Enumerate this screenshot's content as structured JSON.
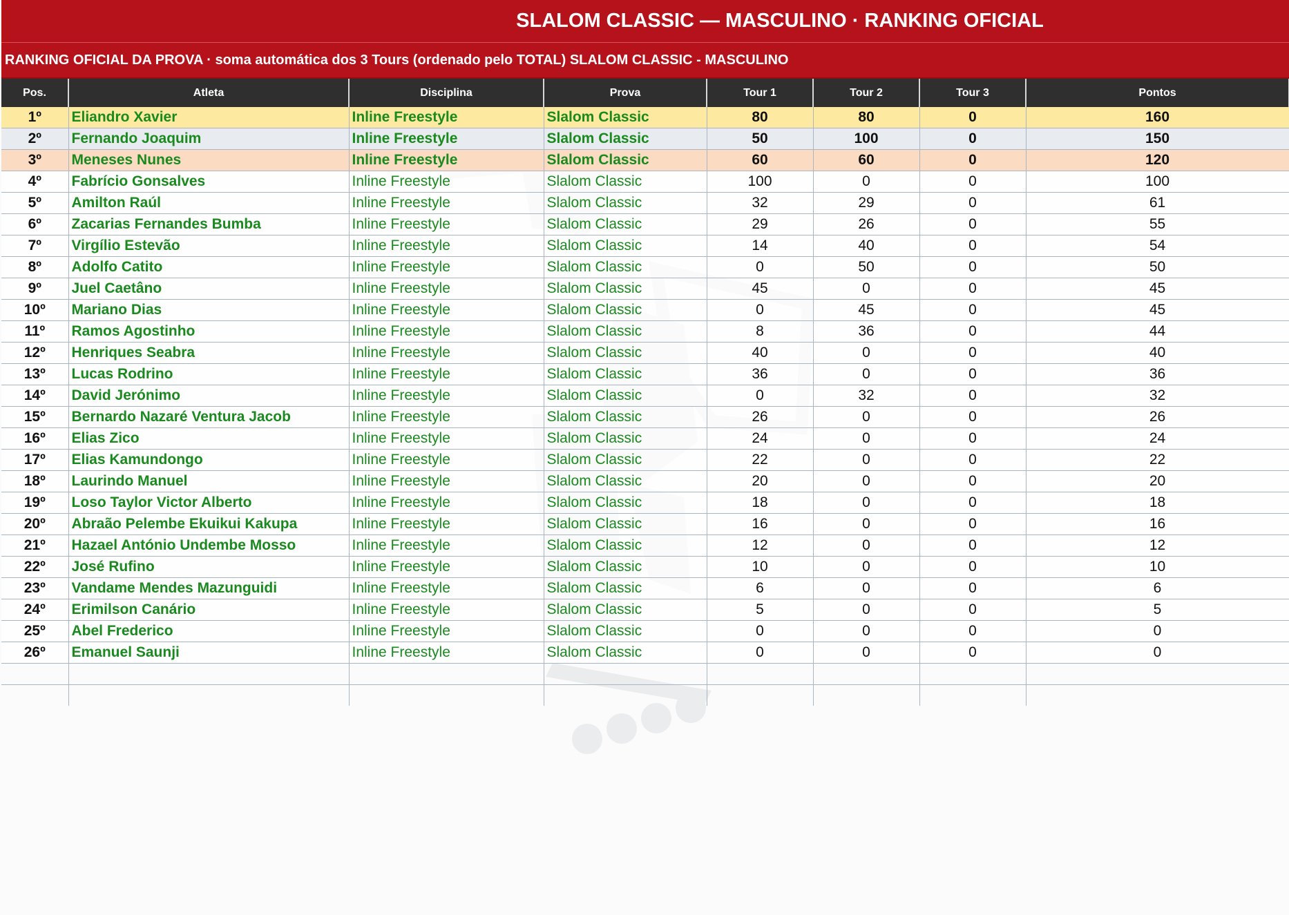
{
  "header": {
    "title": "SLALOM CLASSIC — MASCULINO  ·  RANKING OFICIAL",
    "subtitle": "RANKING OFICIAL DA PROVA  ·  soma automática dos 3 Tours (ordenado pelo TOTAL) SLALOM CLASSIC - MASCULINO"
  },
  "columns": [
    "Pos.",
    "Atleta",
    "Disciplina",
    "Prova",
    "Tour 1",
    "Tour 2",
    "Tour 3",
    "Pontos"
  ],
  "rows": [
    {
      "pos": "1º",
      "atleta": "Eliandro Xavier",
      "disciplina": "Inline Freestyle",
      "prova": "Slalom Classic",
      "t1": "80",
      "t2": "80",
      "t3": "0",
      "pontos": "160"
    },
    {
      "pos": "2º",
      "atleta": "Fernando Joaquim",
      "disciplina": "Inline Freestyle",
      "prova": "Slalom Classic",
      "t1": "50",
      "t2": "100",
      "t3": "0",
      "pontos": "150"
    },
    {
      "pos": "3º",
      "atleta": "Meneses Nunes",
      "disciplina": "Inline Freestyle",
      "prova": "Slalom Classic",
      "t1": "60",
      "t2": "60",
      "t3": "0",
      "pontos": "120"
    },
    {
      "pos": "4º",
      "atleta": "Fabrício Gonsalves",
      "disciplina": "Inline Freestyle",
      "prova": "Slalom Classic",
      "t1": "100",
      "t2": "0",
      "t3": "0",
      "pontos": "100"
    },
    {
      "pos": "5º",
      "atleta": "Amilton Raúl",
      "disciplina": "Inline Freestyle",
      "prova": "Slalom Classic",
      "t1": "32",
      "t2": "29",
      "t3": "0",
      "pontos": "61"
    },
    {
      "pos": "6º",
      "atleta": "Zacarias Fernandes Bumba",
      "disciplina": "Inline Freestyle",
      "prova": "Slalom Classic",
      "t1": "29",
      "t2": "26",
      "t3": "0",
      "pontos": "55"
    },
    {
      "pos": "7º",
      "atleta": "Virgílio Estevão",
      "disciplina": "Inline Freestyle",
      "prova": "Slalom Classic",
      "t1": "14",
      "t2": "40",
      "t3": "0",
      "pontos": "54"
    },
    {
      "pos": "8º",
      "atleta": "Adolfo Catito",
      "disciplina": "Inline Freestyle",
      "prova": "Slalom Classic",
      "t1": "0",
      "t2": "50",
      "t3": "0",
      "pontos": "50"
    },
    {
      "pos": "9º",
      "atleta": "Juel Caetâno",
      "disciplina": "Inline Freestyle",
      "prova": "Slalom Classic",
      "t1": "45",
      "t2": "0",
      "t3": "0",
      "pontos": "45"
    },
    {
      "pos": "10º",
      "atleta": "Mariano Dias",
      "disciplina": "Inline Freestyle",
      "prova": "Slalom Classic",
      "t1": "0",
      "t2": "45",
      "t3": "0",
      "pontos": "45"
    },
    {
      "pos": "11º",
      "atleta": "Ramos Agostinho",
      "disciplina": "Inline Freestyle",
      "prova": "Slalom Classic",
      "t1": "8",
      "t2": "36",
      "t3": "0",
      "pontos": "44"
    },
    {
      "pos": "12º",
      "atleta": "Henriques Seabra",
      "disciplina": "Inline Freestyle",
      "prova": "Slalom Classic",
      "t1": "40",
      "t2": "0",
      "t3": "0",
      "pontos": "40"
    },
    {
      "pos": "13º",
      "atleta": "Lucas Rodrino",
      "disciplina": "Inline Freestyle",
      "prova": "Slalom Classic",
      "t1": "36",
      "t2": "0",
      "t3": "0",
      "pontos": "36"
    },
    {
      "pos": "14º",
      "atleta": "David Jerónimo",
      "disciplina": "Inline Freestyle",
      "prova": "Slalom Classic",
      "t1": "0",
      "t2": "32",
      "t3": "0",
      "pontos": "32"
    },
    {
      "pos": "15º",
      "atleta": "Bernardo Nazaré Ventura Jacob",
      "disciplina": "Inline Freestyle",
      "prova": "Slalom Classic",
      "t1": "26",
      "t2": "0",
      "t3": "0",
      "pontos": "26"
    },
    {
      "pos": "16º",
      "atleta": "Elias Zico",
      "disciplina": "Inline Freestyle",
      "prova": "Slalom Classic",
      "t1": "24",
      "t2": "0",
      "t3": "0",
      "pontos": "24"
    },
    {
      "pos": "17º",
      "atleta": "Elias Kamundongo",
      "disciplina": "Inline Freestyle",
      "prova": "Slalom Classic",
      "t1": "22",
      "t2": "0",
      "t3": "0",
      "pontos": "22"
    },
    {
      "pos": "18º",
      "atleta": "Laurindo Manuel",
      "disciplina": "Inline Freestyle",
      "prova": "Slalom Classic",
      "t1": "20",
      "t2": "0",
      "t3": "0",
      "pontos": "20"
    },
    {
      "pos": "19º",
      "atleta": "Loso Taylor Victor Alberto",
      "disciplina": "Inline Freestyle",
      "prova": "Slalom Classic",
      "t1": "18",
      "t2": "0",
      "t3": "0",
      "pontos": "18"
    },
    {
      "pos": "20º",
      "atleta": "Abraão Pelembe Ekuikui Kakupa",
      "disciplina": "Inline Freestyle",
      "prova": "Slalom Classic",
      "t1": "16",
      "t2": "0",
      "t3": "0",
      "pontos": "16"
    },
    {
      "pos": "21º",
      "atleta": "Hazael António Undembe Mosso",
      "disciplina": "Inline Freestyle",
      "prova": "Slalom Classic",
      "t1": "12",
      "t2": "0",
      "t3": "0",
      "pontos": "12"
    },
    {
      "pos": "22º",
      "atleta": "José Rufino",
      "disciplina": "Inline Freestyle",
      "prova": "Slalom Classic",
      "t1": "10",
      "t2": "0",
      "t3": "0",
      "pontos": "10"
    },
    {
      "pos": "23º",
      "atleta": "Vandame Mendes Mazunguidi",
      "disciplina": "Inline Freestyle",
      "prova": "Slalom Classic",
      "t1": "6",
      "t2": "0",
      "t3": "0",
      "pontos": "6"
    },
    {
      "pos": "24º",
      "atleta": "Erimilson Canário",
      "disciplina": "Inline Freestyle",
      "prova": "Slalom Classic",
      "t1": "5",
      "t2": "0",
      "t3": "0",
      "pontos": "5"
    },
    {
      "pos": "25º",
      "atleta": "Abel Frederico",
      "disciplina": "Inline Freestyle",
      "prova": "Slalom Classic",
      "t1": "0",
      "t2": "0",
      "t3": "0",
      "pontos": "0"
    },
    {
      "pos": "26º",
      "atleta": "Emanuel Saunji",
      "disciplina": "Inline Freestyle",
      "prova": "Slalom Classic",
      "t1": "0",
      "t2": "0",
      "t3": "0",
      "pontos": "0"
    }
  ],
  "colors": {
    "header_red": "#b5121b",
    "column_header": "#2f2f2f",
    "gold_row": "#fde9a0",
    "silver_row": "#e8ebef",
    "bronze_row": "#fbdcc3",
    "athlete_green": "#1a8a1f"
  },
  "watermark_icon": "skater-silhouette-icon"
}
